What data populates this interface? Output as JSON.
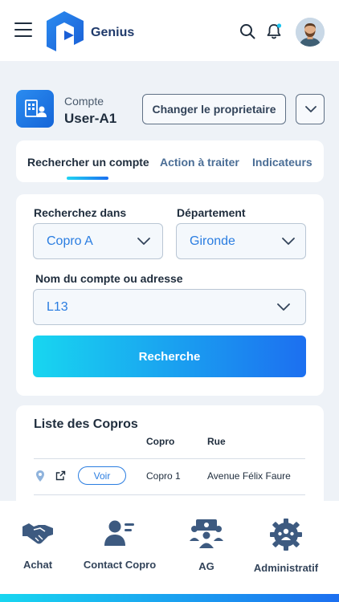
{
  "app": {
    "brand": "Genius"
  },
  "account": {
    "kicker": "Compte",
    "name": "User-A1",
    "change_owner_label": "Changer le proprietaire"
  },
  "tabs": [
    {
      "label": "Rechercher un compte",
      "active": true
    },
    {
      "label": "Action à traiter",
      "active": false
    },
    {
      "label": "Indicateurs",
      "active": false
    }
  ],
  "search": {
    "search_in_label": "Recherchez dans",
    "search_in_value": "Copro A",
    "department_label": "Département",
    "department_value": "Gironde",
    "account_label": "Nom du compte ou adresse",
    "account_value": "L13",
    "submit_label": "Recherche"
  },
  "list": {
    "title": "Liste des Copros",
    "columns": [
      "Copro",
      "Rue"
    ],
    "rows": [
      {
        "action_label": "Voir",
        "copro": "Copro 1",
        "rue": "Avenue Félix Faure"
      }
    ]
  },
  "bottom_nav": [
    {
      "label": "Achat",
      "icon": "handshake-icon"
    },
    {
      "label": "Contact Copro",
      "icon": "contact-icon"
    },
    {
      "label": "AG",
      "icon": "meeting-icon"
    },
    {
      "label": "Administratif",
      "icon": "gear-people-icon"
    }
  ],
  "colors": {
    "accent": "#2a7de1",
    "gradient_start": "#18d6f0",
    "gradient_end": "#1c6ff0",
    "background": "#eef2f7",
    "text": "#1f2d3d"
  }
}
